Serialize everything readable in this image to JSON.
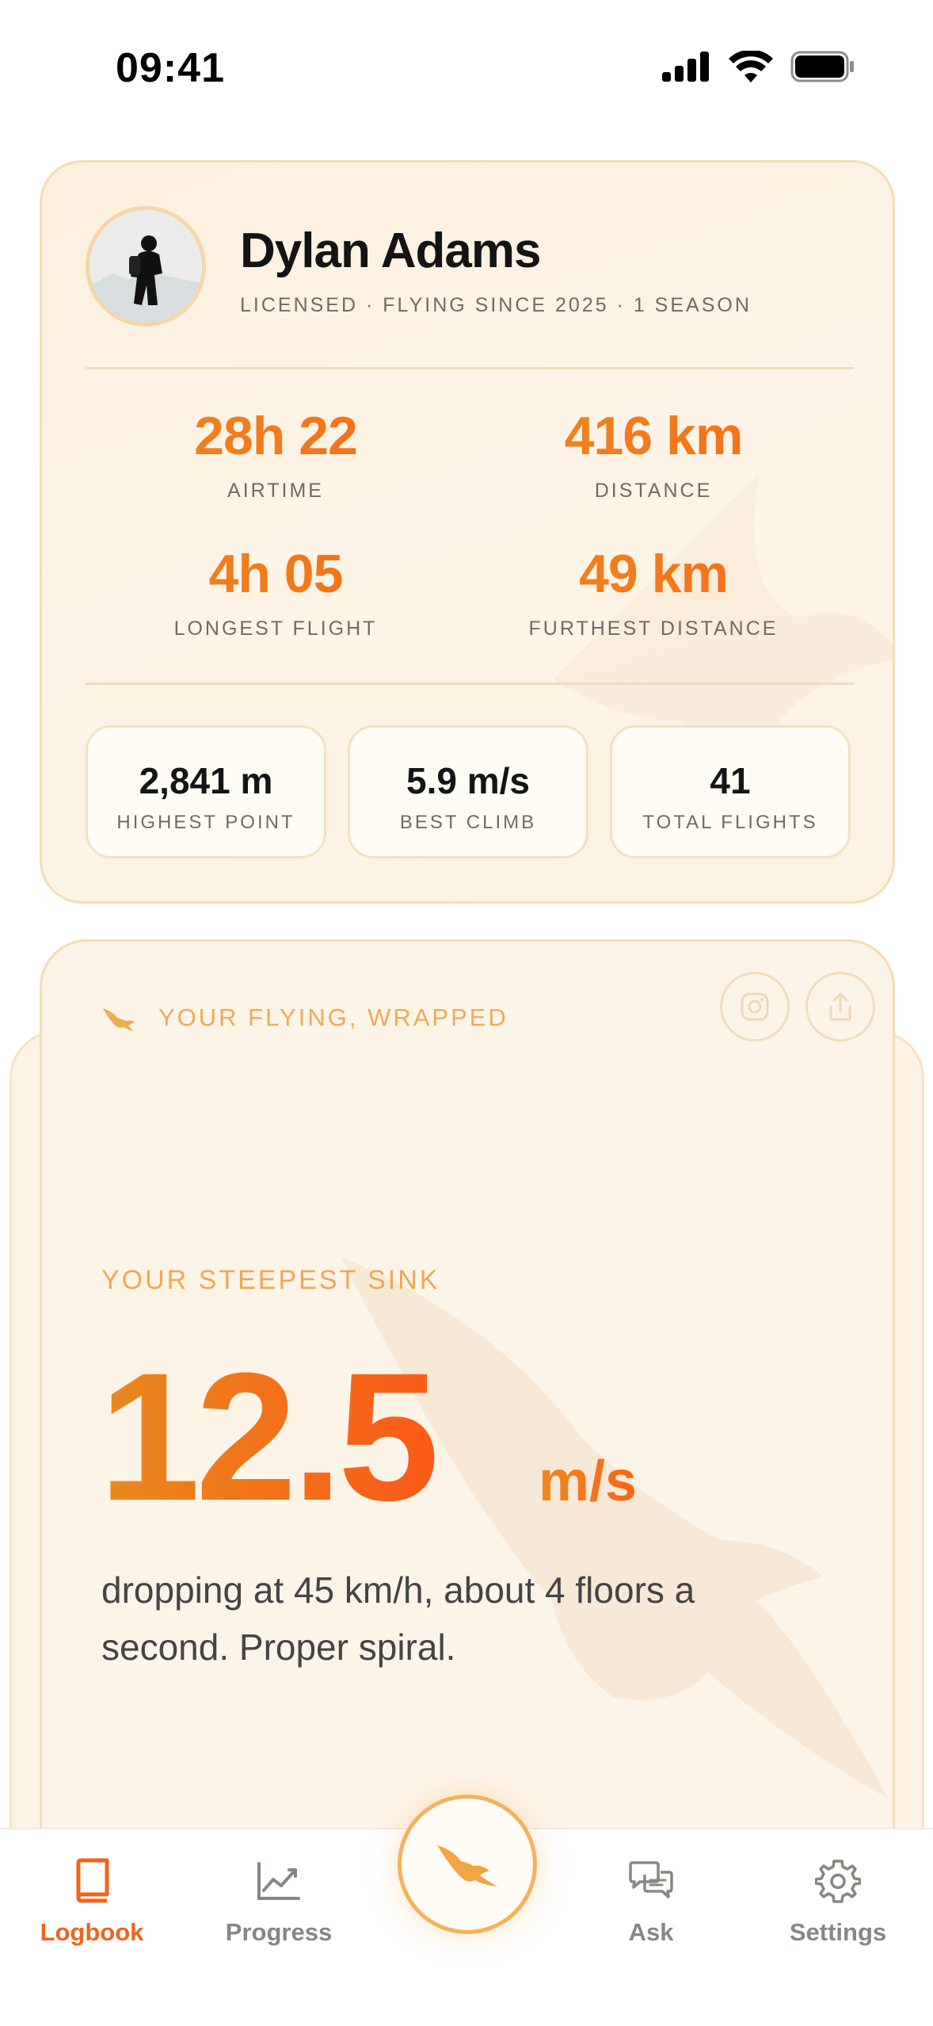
{
  "status_bar": {
    "time": "09:41"
  },
  "profile": {
    "name": "Dylan Adams",
    "subtitle": "LICENSED · FLYING SINCE 2025 · 1 SEASON",
    "stats": [
      {
        "value": "28h 22",
        "label": "AIRTIME"
      },
      {
        "value": "416 km",
        "label": "DISTANCE"
      },
      {
        "value": "4h 05",
        "label": "LONGEST FLIGHT"
      },
      {
        "value": "49 km",
        "label": "FURTHEST DISTANCE"
      }
    ],
    "mini_stats": [
      {
        "value": "2,841 m",
        "label": "HIGHEST POINT"
      },
      {
        "value": "5.9 m/s",
        "label": "BEST CLIMB"
      },
      {
        "value": "41",
        "label": "TOTAL FLIGHTS"
      }
    ]
  },
  "wrapped": {
    "title": "YOUR FLYING, WRAPPED",
    "stat_label": "YOUR STEEPEST SINK",
    "stat_value": "12.5",
    "stat_unit": "m/s",
    "description": "dropping at 45 km/h, about 4 floors a second. Proper spiral."
  },
  "tab_bar": {
    "items": [
      {
        "label": "Logbook",
        "icon": "book-icon",
        "active": true
      },
      {
        "label": "Progress",
        "icon": "chart-icon",
        "active": false
      },
      {
        "label": "Ask",
        "icon": "chat-icon",
        "active": false
      },
      {
        "label": "Settings",
        "icon": "gear-icon",
        "active": false
      }
    ],
    "center_icon": "bird-icon"
  },
  "colors": {
    "accent": "#f0641c",
    "accent_light": "#efab55",
    "card_bg": "#fdf4e8"
  }
}
